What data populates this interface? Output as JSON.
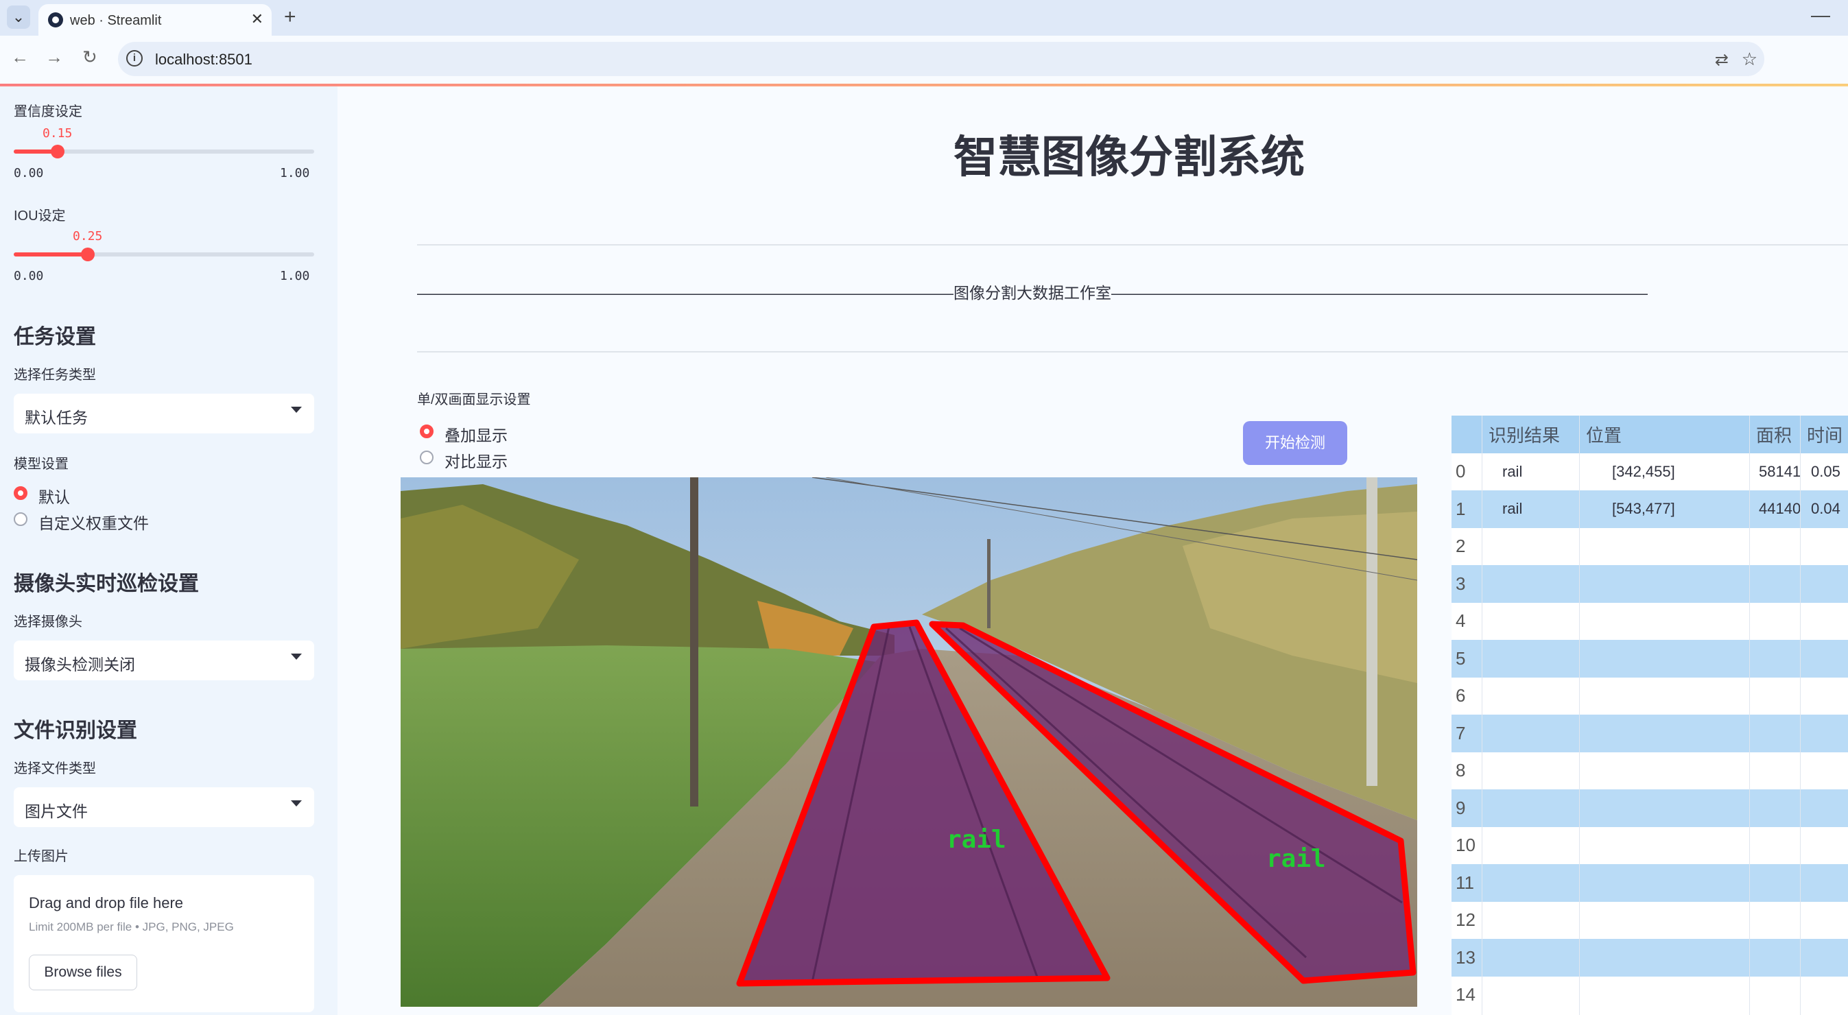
{
  "browser": {
    "tab_title": "web · Streamlit",
    "url": "localhost:8501"
  },
  "sidebar": {
    "confidence": {
      "label": "置信度设定",
      "value": 0.15,
      "value_text": "0.15",
      "min": "0.00",
      "max": "1.00"
    },
    "iou": {
      "label": "IOU设定",
      "value": 0.25,
      "value_text": "0.25",
      "min": "0.00",
      "max": "1.00"
    },
    "task_heading": "任务设置",
    "task_type_label": "选择任务类型",
    "task_type_value": "默认任务",
    "model_label": "模型设置",
    "model_options": [
      "默认",
      "自定义权重文件"
    ],
    "model_selected": 0,
    "camera_heading": "摄像头实时巡检设置",
    "camera_label": "选择摄像头",
    "camera_value": "摄像头检测关闭",
    "file_heading": "文件识别设置",
    "file_type_label": "选择文件类型",
    "file_type_value": "图片文件",
    "upload_label": "上传图片",
    "upload_title": "Drag and drop file here",
    "upload_limit": "Limit 200MB per file • JPG, PNG, JPEG",
    "browse_button": "Browse files"
  },
  "main": {
    "title": "智慧图像分割系统",
    "banner": "——————————————————————————————————图像分割大数据工作室——————————————————————————————————",
    "display_mode_label": "单/双画面显示设置",
    "display_modes": [
      "叠加显示",
      "对比显示"
    ],
    "display_selected": 0,
    "detect_button": "开始检测",
    "detections_on_image": [
      "rail",
      "rail"
    ]
  },
  "table": {
    "columns": [
      "识别结果",
      "位置",
      "面积",
      "时间"
    ],
    "rows": [
      {
        "index": "0",
        "result": "rail",
        "position": "[342,455]",
        "area": "58141",
        "time": "0.05"
      },
      {
        "index": "1",
        "result": "rail",
        "position": "[543,477]",
        "area": "44140",
        "time": "0.04"
      },
      {
        "index": "2"
      },
      {
        "index": "3"
      },
      {
        "index": "4"
      },
      {
        "index": "5"
      },
      {
        "index": "6"
      },
      {
        "index": "7"
      },
      {
        "index": "8"
      },
      {
        "index": "9"
      },
      {
        "index": "10"
      },
      {
        "index": "11"
      },
      {
        "index": "12"
      },
      {
        "index": "13"
      },
      {
        "index": "14"
      }
    ]
  },
  "colors": {
    "accent": "#ff4b4b",
    "button": "#8d95f2",
    "table_header": "#a9d2f3",
    "table_alt_row": "#b9dbf6",
    "mask": "#7a2a7a",
    "outline": "#ff0000",
    "label_text": "#22cc33"
  }
}
